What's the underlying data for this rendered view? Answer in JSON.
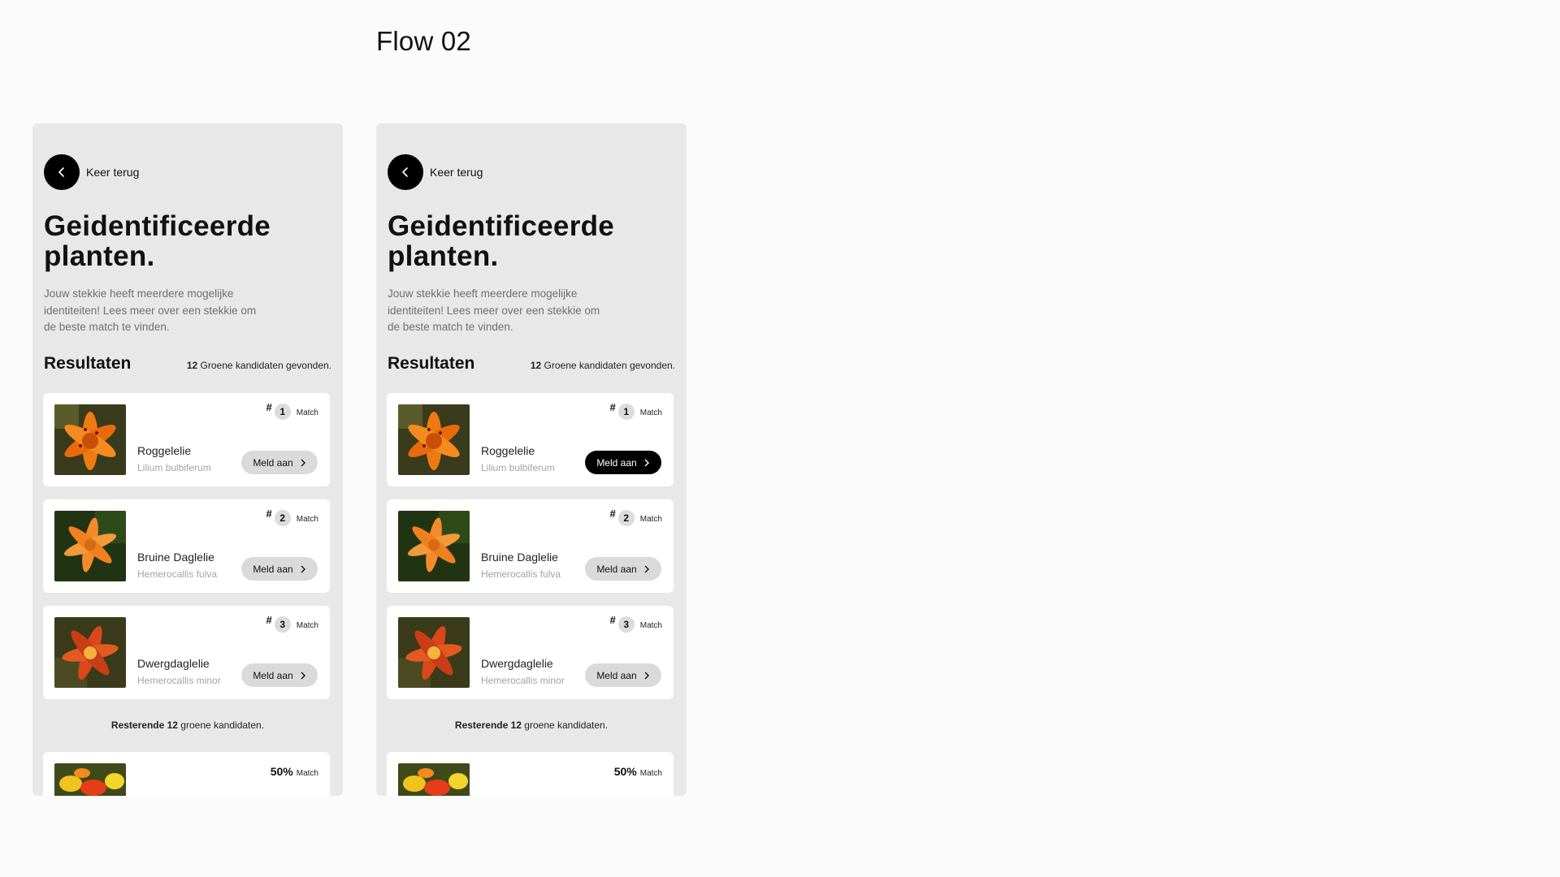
{
  "flow_title": "Flow 02",
  "screens": [
    {
      "back_label": "Keer terug",
      "heading": "Geidentificeerde planten.",
      "intro": "Jouw stekkie heeft meerdere mogelijke identiteiten! Lees meer over een stekkie om de beste match te vinden.",
      "results_title": "Resultaten",
      "results_count": "12",
      "results_count_text": " Groene kandidaten gevonden.",
      "cards": [
        {
          "rank_hash": "#",
          "rank": "1",
          "match_label": "Match",
          "name": "Roggelelie",
          "latin": "Lilium bulbiferum",
          "button": "Meld aan",
          "button_active": false
        },
        {
          "rank_hash": "#",
          "rank": "2",
          "match_label": "Match",
          "name": "Bruine Daglelie",
          "latin": "Hemerocallis fulva",
          "button": "Meld aan",
          "button_active": false
        },
        {
          "rank_hash": "#",
          "rank": "3",
          "match_label": "Match",
          "name": "Dwergdaglelie",
          "latin": "Hemerocallis minor",
          "button": "Meld aan",
          "button_active": false
        }
      ],
      "remaining_bold": "Resterende 12",
      "remaining_text": " groene kandidaten.",
      "partial_card": {
        "percent": "50%",
        "match_label": "Match"
      }
    },
    {
      "back_label": "Keer terug",
      "heading": "Geidentificeerde planten.",
      "intro": "Jouw stekkie heeft meerdere mogelijke identiteiten! Lees meer over een stekkie om de beste match te vinden.",
      "results_title": "Resultaten",
      "results_count": "12",
      "results_count_text": " Groene kandidaten gevonden.",
      "cards": [
        {
          "rank_hash": "#",
          "rank": "1",
          "match_label": "Match",
          "name": "Roggelelie",
          "latin": "Lilium bulbiferum",
          "button": "Meld aan",
          "button_active": true
        },
        {
          "rank_hash": "#",
          "rank": "2",
          "match_label": "Match",
          "name": "Bruine Daglelie",
          "latin": "Hemerocallis fulva",
          "button": "Meld aan",
          "button_active": false
        },
        {
          "rank_hash": "#",
          "rank": "3",
          "match_label": "Match",
          "name": "Dwergdaglelie",
          "latin": "Hemerocallis minor",
          "button": "Meld aan",
          "button_active": false
        }
      ],
      "remaining_bold": "Resterende 12",
      "remaining_text": " groene kandidaten.",
      "partial_card": {
        "percent": "50%",
        "match_label": "Match"
      }
    }
  ],
  "icons": {
    "back": "chevron-left-icon",
    "button_arrow": "chevron-right-icon",
    "thumbnails": [
      "orange-lily-photo",
      "daylily-photo",
      "red-daylily-photo",
      "mixed-lilies-photo"
    ]
  },
  "colors": {
    "page_bg": "#fbfbfb",
    "screen_bg": "#e8e8e8",
    "card_bg": "#ffffff",
    "button_bg": "#dadada",
    "button_active_bg": "#000000",
    "muted_text": "#6f6f6f"
  }
}
